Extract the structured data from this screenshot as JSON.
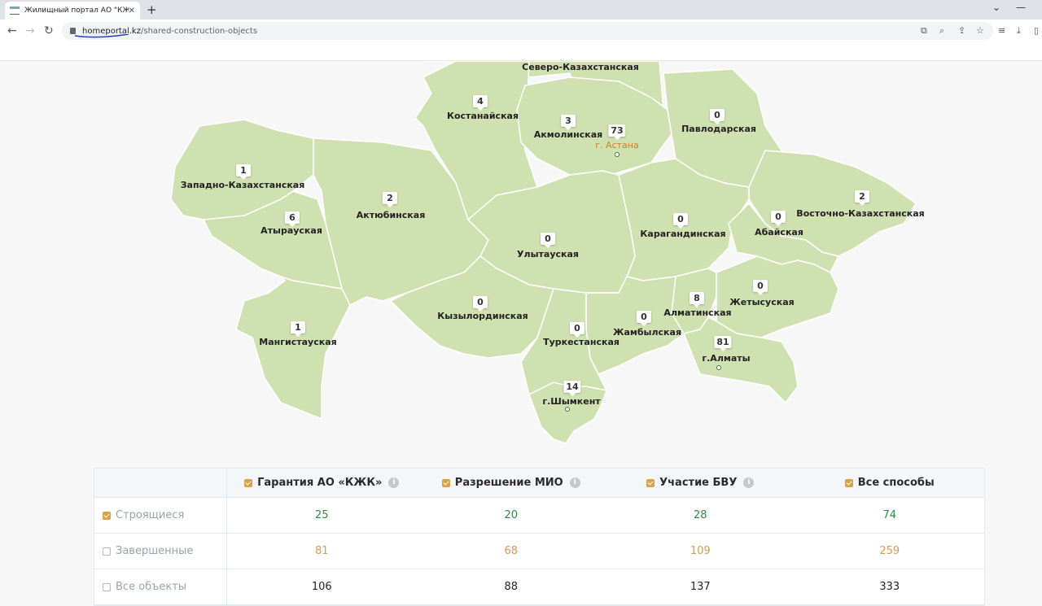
{
  "browser": {
    "tab_title": "Жилищный портал АО \"КЖК\"",
    "url_host": "homeportal.kz",
    "url_path": "/shared-construction-objects"
  },
  "map": {
    "fill": "#cfe1b0",
    "stroke": "#ffffff",
    "regions": [
      {
        "name": "Северо-Казахстанская",
        "count": null
      },
      {
        "name": "Костанайская",
        "count": "4"
      },
      {
        "name": "Акмолинская",
        "count": "3"
      },
      {
        "name": "г. Астана",
        "count": "73"
      },
      {
        "name": "Павлодарская",
        "count": "0"
      },
      {
        "name": "Западно-Казахстанская",
        "count": "1"
      },
      {
        "name": "Актюбинская",
        "count": "2"
      },
      {
        "name": "Атырауская",
        "count": "6"
      },
      {
        "name": "Восточно-Казахстанская",
        "count": "2"
      },
      {
        "name": "Карагандинская",
        "count": "0"
      },
      {
        "name": "Абайская",
        "count": "0"
      },
      {
        "name": "Улытауская",
        "count": "0"
      },
      {
        "name": "Кызылординская",
        "count": "0"
      },
      {
        "name": "Мангистауская",
        "count": "1"
      },
      {
        "name": "Алматинская",
        "count": "8"
      },
      {
        "name": "Жетысуская",
        "count": "0"
      },
      {
        "name": "Жамбылская",
        "count": "0"
      },
      {
        "name": "Туркестанская",
        "count": "0"
      },
      {
        "name": "г.Алматы",
        "count": "81"
      },
      {
        "name": "г.Шымкент",
        "count": "14"
      }
    ]
  },
  "table": {
    "columns": [
      "Гарантия АО «КЖК»",
      "Разрешение МИО",
      "Участие БВУ",
      "Все способы"
    ],
    "rows": [
      {
        "label": "Строящиеся",
        "checked": true,
        "values": [
          "25",
          "20",
          "28",
          "74"
        ]
      },
      {
        "label": "Завершенные",
        "checked": false,
        "values": [
          "81",
          "68",
          "109",
          "259"
        ]
      },
      {
        "label": "Все объекты",
        "checked": false,
        "values": [
          "106",
          "88",
          "137",
          "333"
        ]
      }
    ]
  },
  "colors": {
    "accent": "#d9a24a",
    "green_value": "#2e8a4a",
    "orange_value": "#d79a55"
  }
}
